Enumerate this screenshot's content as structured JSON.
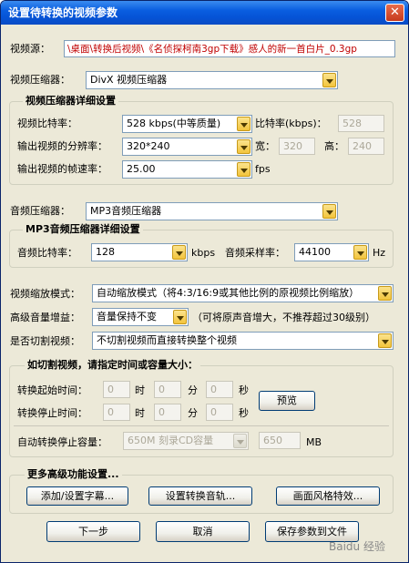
{
  "window": {
    "title": "设置待转换的视频参数",
    "close_glyph": "✕"
  },
  "source": {
    "label": "视频源：",
    "value": "\\桌面\\转换后视频\\《名侦探柯南3gp下载》感人的新一首白片_0.3gp"
  },
  "video_codec": {
    "label": "视频压缩器：",
    "value": "DivX 视频压缩器"
  },
  "video_details": {
    "title": "视频压缩器详细设置",
    "bitrate_label": "视频比特率：",
    "bitrate_value": "528  kbps(中等质量)",
    "bitrate_custom_label": "比特率(kbps)：",
    "bitrate_custom_value": "528",
    "resolution_label": "输出视频的分辨率：",
    "resolution_value": "320*240",
    "width_label": "宽：",
    "width_value": "320",
    "height_label": "高：",
    "height_value": "240",
    "framerate_label": "输出视频的帧速率：",
    "framerate_value": "25.00",
    "framerate_unit": "fps"
  },
  "audio_codec": {
    "label": "音频压缩器：",
    "value": "MP3音频压缩器"
  },
  "audio_details": {
    "title": "MP3音频压缩器详细设置",
    "bitrate_label": "音频比特率：",
    "bitrate_value": "128",
    "bitrate_unit": "kbps",
    "samplerate_label": "音频采样率：",
    "samplerate_value": "44100",
    "samplerate_unit": "Hz"
  },
  "scale_mode": {
    "label": "视频缩放模式：",
    "value": "自动缩放模式（将4:3/16:9或其他比例的原视频比例缩放）"
  },
  "volume_gain": {
    "label": "高级音量增益：",
    "value": "音量保持不变",
    "note": "（可将原声音增大，不推荐超过30级别）"
  },
  "cut_video": {
    "label": "是否切割视频：",
    "value": "不切割视频而直接转换整个视频"
  },
  "cut_settings": {
    "title": "如切割视频，请指定时间或容量大小：",
    "start_label": "转换起始时间：",
    "stop_label": "转换停止时间：",
    "hour": "时",
    "minute": "分",
    "second": "秒",
    "start_h": "0",
    "start_m": "0",
    "start_s": "0",
    "stop_h": "0",
    "stop_m": "0",
    "stop_s": "0",
    "preview_label": "预览",
    "capacity_label": "自动转换停止容量：",
    "capacity_value": "650M 刻录CD容量",
    "capacity_custom": "650",
    "capacity_unit": "MB"
  },
  "advanced": {
    "title": "更多高级功能设置...",
    "subtitle_btn": "添加/设置字幕...",
    "audio_track_btn": "设置转换音轨...",
    "effects_btn": "画面风格特效..."
  },
  "footer": {
    "next_btn": "下一步",
    "cancel_btn": "取消",
    "save_btn": "保存参数到文件"
  },
  "watermark": "Baidu 经验"
}
